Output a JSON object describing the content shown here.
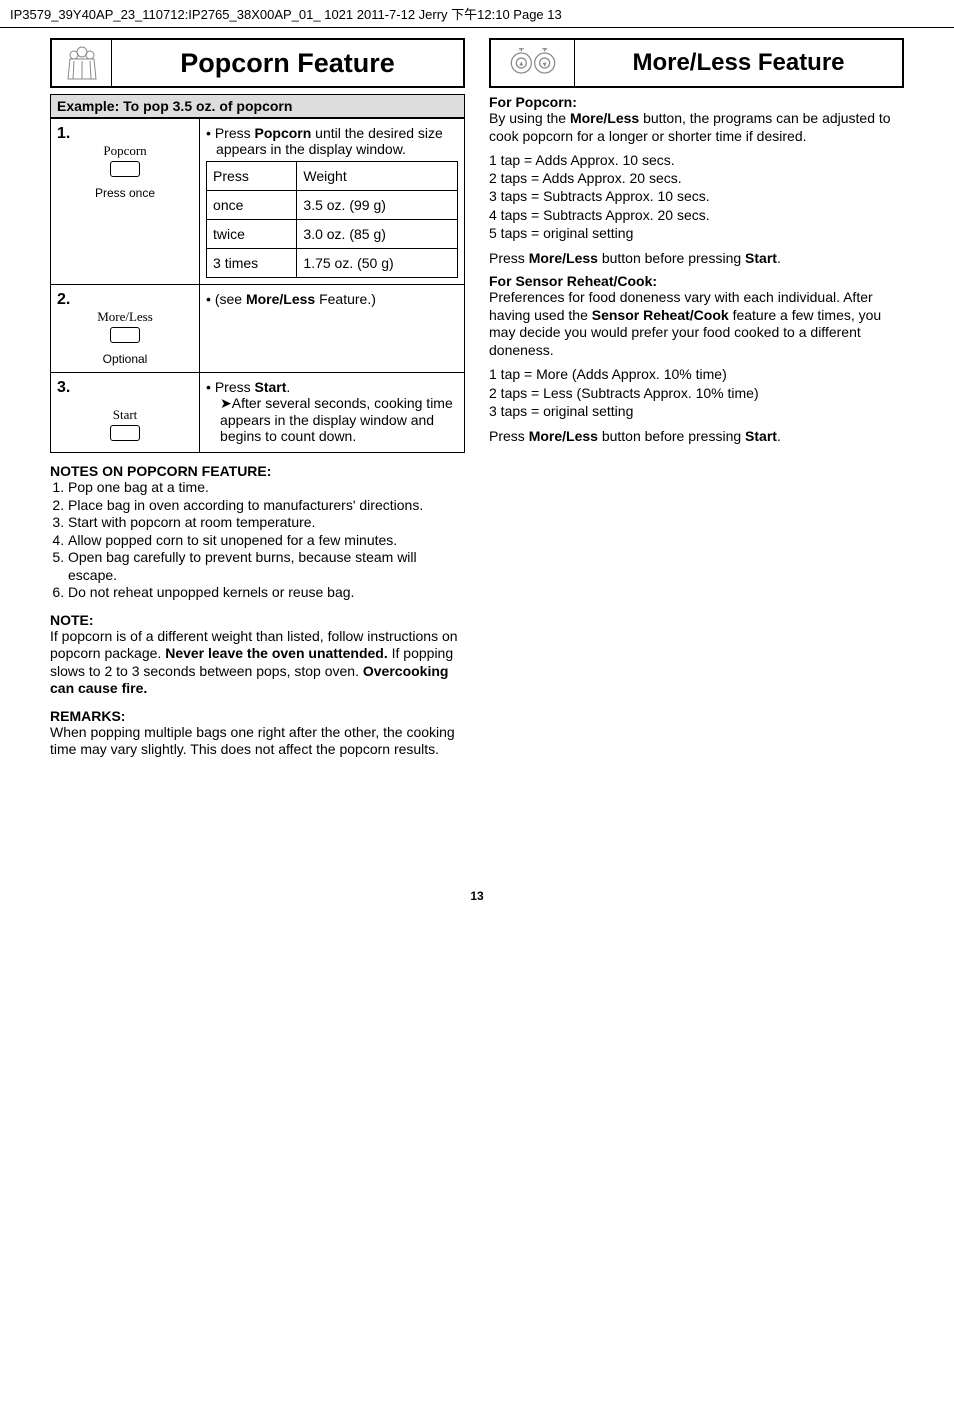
{
  "header_line": "IP3579_39Y40AP_23_110712:IP2765_38X00AP_01_  1021  2011-7-12  Jerry  下午12:10  Page 13",
  "left": {
    "title": "Popcorn Feature",
    "example_heading": "Example: To pop 3.5 oz. of popcorn",
    "step1": {
      "num": "1.",
      "btn_label": "Popcorn",
      "press_text": "Press once",
      "bullet_prefix": "• Press ",
      "bullet_bold": "Popcorn",
      "bullet_suffix": " until the desired size appears in the display window.",
      "table": {
        "h1": "Press",
        "h2": "Weight",
        "rows": [
          {
            "a": "once",
            "b": "3.5 oz. (99 g)"
          },
          {
            "a": "twice",
            "b": "3.0 oz. (85 g)"
          },
          {
            "a": "3 times",
            "b": "1.75 oz. (50 g)"
          }
        ]
      }
    },
    "step2": {
      "num": "2.",
      "btn_label": "More/Less",
      "press_text": "Optional",
      "bullet_prefix": "• (see ",
      "bullet_bold": "More/Less",
      "bullet_suffix": " Feature.)"
    },
    "step3": {
      "num": "3.",
      "btn_label": "Start",
      "bullet_prefix": "• Press ",
      "bullet_bold": "Start",
      "bullet_suffix": ".",
      "arrow_text": "After several seconds, cooking time appears in the display window and begins to count down."
    },
    "notes_heading": "NOTES ON POPCORN FEATURE:",
    "notes": [
      "Pop one bag at a time.",
      "Place bag in oven according to manufacturers' directions.",
      "Start with popcorn at room temperature.",
      "Allow popped corn to sit unopened for a few minutes.",
      "Open bag carefully to prevent burns, because steam will escape.",
      "Do not reheat unpopped kernels or reuse bag."
    ],
    "note_heading": "NOTE:",
    "note_body_a": "If popcorn is of a different weight than listed, follow instructions on popcorn package. ",
    "note_bold_a": "Never leave the oven unattended.",
    "note_body_b": " If popping slows to 2 to 3 seconds between pops, stop oven. ",
    "note_bold_b": "Overcooking can cause fire.",
    "remarks_heading": "REMARKS:",
    "remarks_body": "When popping multiple bags one right after the other, the cooking time may vary slightly. This does not affect the popcorn results."
  },
  "right": {
    "title": "More/Less Feature",
    "popcorn_heading": "For Popcorn:",
    "popcorn_intro_a": "By using the ",
    "popcorn_intro_bold": "More/Less",
    "popcorn_intro_b": " button, the programs can be adjusted to cook popcorn for a longer or shorter time if desired.",
    "taps_popcorn": [
      "1 tap = Adds Approx. 10 secs.",
      "2 taps = Adds Approx. 20 secs.",
      "3 taps = Subtracts Approx. 10 secs.",
      "4 taps = Subtracts Approx. 20 secs.",
      "5 taps = original setting"
    ],
    "press_line_a": "Press ",
    "press_bold_a": "More/Less",
    "press_line_b": " button before pressing ",
    "press_bold_b": "Start",
    "press_line_c": ".",
    "sensor_heading": "For Sensor Reheat/Cook:",
    "sensor_body_a": "Preferences for food doneness vary with each individual. After having used the ",
    "sensor_bold": "Sensor Reheat/Cook",
    "sensor_body_b": " feature a few times, you may decide you would prefer your food cooked to a different doneness.",
    "taps_sensor": [
      "1 tap = More (Adds Approx. 10% time)",
      "2 taps = Less (Subtracts Approx. 10% time)",
      "3 taps = original setting"
    ]
  },
  "page_number": "13"
}
